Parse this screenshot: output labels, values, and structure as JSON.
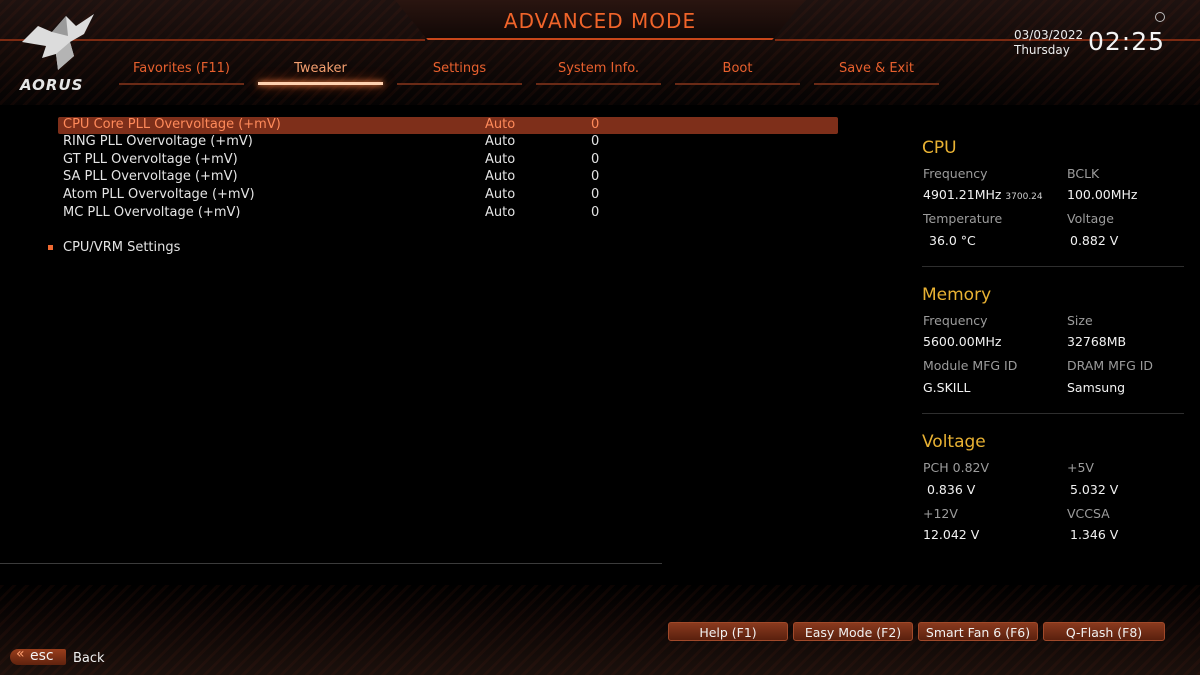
{
  "header": {
    "title": "ADVANCED MODE",
    "logo_text": "AORUS",
    "date": "03/03/2022",
    "day": "Thursday",
    "time": "02:25"
  },
  "tabs": [
    {
      "label": "Favorites (F11)",
      "active": false
    },
    {
      "label": "Tweaker",
      "active": true
    },
    {
      "label": "Settings",
      "active": false
    },
    {
      "label": "System Info.",
      "active": false
    },
    {
      "label": "Boot",
      "active": false
    },
    {
      "label": "Save & Exit",
      "active": false
    }
  ],
  "settings": [
    {
      "label": "CPU Core PLL Overvoltage (+mV)",
      "mode": "Auto",
      "value": "0",
      "selected": true
    },
    {
      "label": "RING PLL Overvoltage (+mV)",
      "mode": "Auto",
      "value": "0",
      "selected": false
    },
    {
      "label": "GT PLL Overvoltage (+mV)",
      "mode": "Auto",
      "value": "0",
      "selected": false
    },
    {
      "label": "SA PLL Overvoltage (+mV)",
      "mode": "Auto",
      "value": "0",
      "selected": false
    },
    {
      "label": "Atom PLL Overvoltage (+mV)",
      "mode": "Auto",
      "value": "0",
      "selected": false
    },
    {
      "label": "MC PLL Overvoltage (+mV)",
      "mode": "Auto",
      "value": "0",
      "selected": false
    }
  ],
  "submenu": {
    "label": "CPU/VRM Settings"
  },
  "cpu": {
    "title": "CPU",
    "frequency_label": "Frequency",
    "frequency": "4901.21MHz",
    "frequency_sub": "3700.24",
    "bclk_label": "BCLK",
    "bclk": "100.00MHz",
    "temperature_label": "Temperature",
    "temperature": "36.0 °C",
    "voltage_label": "Voltage",
    "voltage": "0.882 V"
  },
  "memory": {
    "title": "Memory",
    "frequency_label": "Frequency",
    "frequency": "5600.00MHz",
    "size_label": "Size",
    "size": "32768MB",
    "module_mfg_label": "Module MFG ID",
    "module_mfg": "G.SKILL",
    "dram_mfg_label": "DRAM MFG ID",
    "dram_mfg": "Samsung"
  },
  "voltage": {
    "title": "Voltage",
    "pch_label": "PCH 0.82V",
    "pch": "0.836 V",
    "v5_label": "+5V",
    "v5": "5.032 V",
    "v12_label": "+12V",
    "v12": "12.042 V",
    "vccsa_label": "VCCSA",
    "vccsa": "1.346 V"
  },
  "footer": {
    "buttons": [
      "Help (F1)",
      "Easy Mode (F2)",
      "Smart Fan 6 (F6)",
      "Q-Flash (F8)"
    ],
    "esc_label": "esc",
    "back_label": "Back"
  },
  "colors": {
    "accent": "#e8602e",
    "highlight_row": "#7e2f1a",
    "section_title": "#e9b233",
    "button_bg": "#7a3218"
  }
}
